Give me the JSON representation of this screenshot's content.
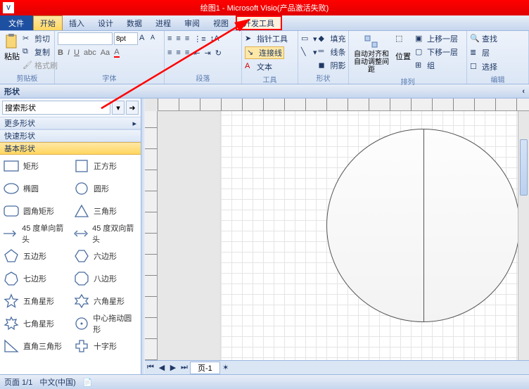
{
  "title": "绘图1 - Microsoft Visio(产品激活失败)",
  "app_icon_letter": "V",
  "menu": {
    "file": "文件",
    "home": "开始",
    "insert": "插入",
    "design": "设计",
    "data": "数据",
    "process": "进程",
    "review": "审阅",
    "view": "视图",
    "dev": "开发工具"
  },
  "ribbon": {
    "clipboard": {
      "label": "剪贴板",
      "paste": "粘贴",
      "cut": "剪切",
      "copy": "复制",
      "format": "格式刷"
    },
    "font": {
      "label": "字体",
      "size": "8pt"
    },
    "paragraph": {
      "label": "段落"
    },
    "tools": {
      "label": "工具",
      "pointer": "指针工具",
      "connector": "连接线",
      "text": "文本"
    },
    "shapes": {
      "label": "形状",
      "fill": "填充",
      "line": "线条",
      "shadow": "阴影"
    },
    "arrange": {
      "label": "排列",
      "align": "自动对齐和自动调整间距",
      "position": "位置",
      "front": "上移一层",
      "back": "下移一层",
      "group": "组"
    },
    "edit": {
      "label": "编辑",
      "find": "查找",
      "layer": "层",
      "select": "选择"
    }
  },
  "shapes_panel": {
    "title": "形状",
    "search_placeholder": "搜索形状",
    "categories": {
      "more": "更多形状",
      "quick": "快速形状",
      "basic": "基本形状"
    },
    "items": [
      {
        "name": "矩形",
        "icon": "rect"
      },
      {
        "name": "正方形",
        "icon": "square"
      },
      {
        "name": "椭圆",
        "icon": "ellipse"
      },
      {
        "name": "圆形",
        "icon": "circle"
      },
      {
        "name": "圆角矩形",
        "icon": "roundrect"
      },
      {
        "name": "三角形",
        "icon": "triangle"
      },
      {
        "name": "45 度单向箭头",
        "icon": "arrow1"
      },
      {
        "name": "45 度双向箭头",
        "icon": "arrow2"
      },
      {
        "name": "五边形",
        "icon": "pentagon"
      },
      {
        "name": "六边形",
        "icon": "hexagon"
      },
      {
        "name": "七边形",
        "icon": "heptagon"
      },
      {
        "name": "八边形",
        "icon": "octagon"
      },
      {
        "name": "五角星形",
        "icon": "star5"
      },
      {
        "name": "六角星形",
        "icon": "star6"
      },
      {
        "name": "七角星形",
        "icon": "star7"
      },
      {
        "name": "中心拖动圆形",
        "icon": "centercircle"
      },
      {
        "name": "直角三角形",
        "icon": "rtriangle"
      },
      {
        "name": "十字形",
        "icon": "cross"
      }
    ]
  },
  "page_tab": "页-1",
  "status": {
    "page": "页面 1/1",
    "lang": "中文(中国)"
  }
}
